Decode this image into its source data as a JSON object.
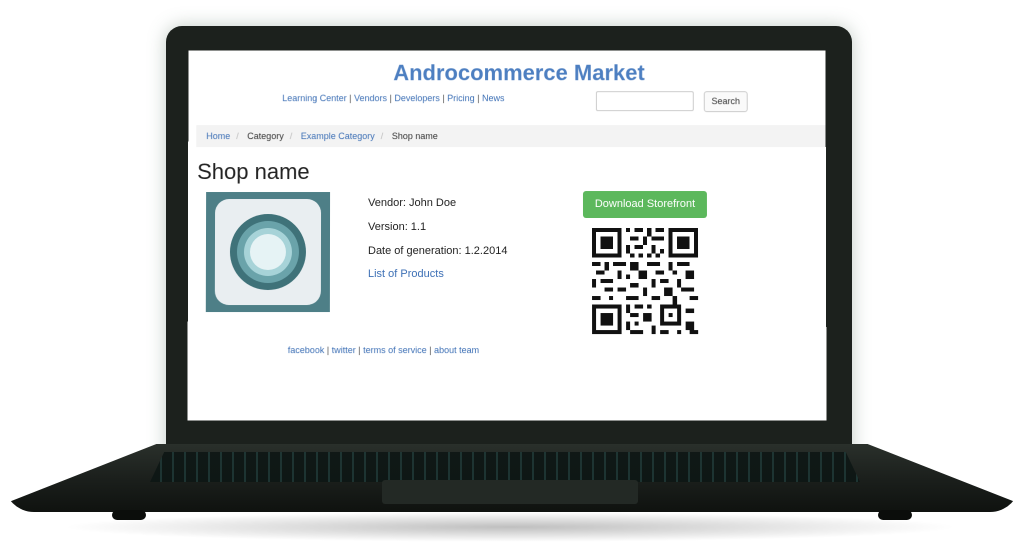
{
  "site": {
    "title": "Androcommerce Market",
    "nav": [
      "Learning Center",
      "Vendors",
      "Developers",
      "Pricing",
      "News"
    ],
    "search_button": "Search",
    "search_value": ""
  },
  "breadcrumb": [
    "Home",
    "Category",
    "Example Category",
    "Shop name"
  ],
  "shop": {
    "title": "Shop name",
    "vendor": "Vendor: John Doe",
    "version": "Version: 1.1",
    "date": "Date of generation: 1.2.2014",
    "products_link": "List of Products",
    "download_button": "Download Storefront"
  },
  "footer": [
    "facebook",
    "twitter",
    "terms of service",
    "about team"
  ],
  "colors": {
    "link": "#3c6fb5",
    "title": "#4d7fc1",
    "download_button": "#5cb85c",
    "icon_bg": "#4e7f87"
  },
  "icons": {
    "app_icon": "concentric-circles-icon",
    "qr_code": "qr-code-icon"
  }
}
